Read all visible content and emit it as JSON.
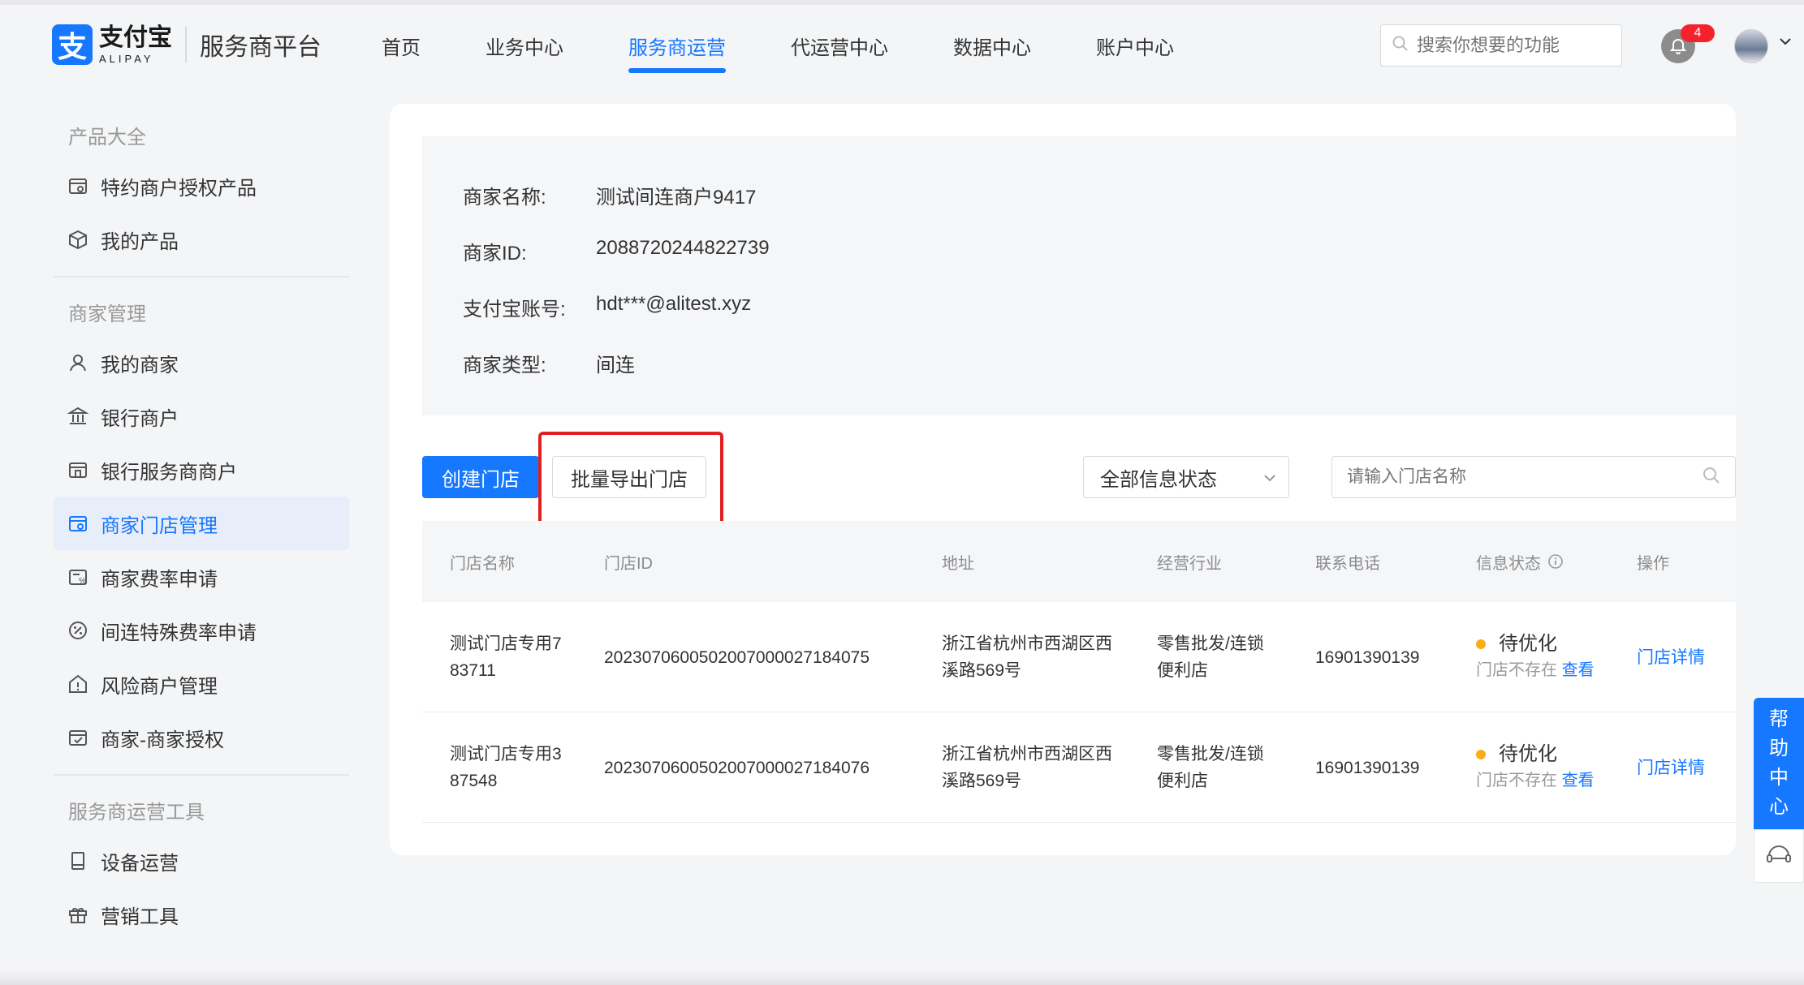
{
  "header": {
    "logo_cn": "支付宝",
    "logo_en": "ALIPAY",
    "platform": "服务商平台",
    "nav": [
      "首页",
      "业务中心",
      "服务商运营",
      "代运营中心",
      "数据中心",
      "账户中心"
    ],
    "active_nav": "服务商运营",
    "search_placeholder": "搜索你想要的功能",
    "notification_count": "4"
  },
  "sidebar": {
    "groups": [
      {
        "title": "产品大全",
        "items": [
          "特约商户授权产品",
          "我的产品"
        ]
      },
      {
        "title": "商家管理",
        "items": [
          "我的商家",
          "银行商户",
          "银行服务商商户",
          "商家门店管理",
          "商家费率申请",
          "间连特殊费率申请",
          "风险商户管理",
          "商家-商家授权"
        ]
      },
      {
        "title": "服务商运营工具",
        "items": [
          "设备运营",
          "营销工具"
        ]
      }
    ],
    "active_item": "商家门店管理"
  },
  "merchant": {
    "name_label": "商家名称:",
    "name": "测试间连商户9417",
    "id_label": "商家ID:",
    "id": "2088720244822739",
    "account_label": "支付宝账号:",
    "account": "hdt***@alitest.xyz",
    "type_label": "商家类型:",
    "type": "间连"
  },
  "toolbar": {
    "create_label": "创建门店",
    "export_label": "批量导出门店",
    "status_select": "全部信息状态",
    "store_search_placeholder": "请输入门店名称"
  },
  "table": {
    "headers": [
      "门店名称",
      "门店ID",
      "地址",
      "经营行业",
      "联系电话",
      "信息状态",
      "操作"
    ],
    "rows": [
      {
        "name_line1": "测试门店专用7",
        "name_line2": "83711",
        "store_id": "2023070600502007000027184075",
        "address_line1": "浙江省杭州市西湖区西",
        "address_line2": "溪路569号",
        "industry_line1": "零售批发/连锁",
        "industry_line2": "便利店",
        "phone": "16901390139",
        "status": "待优化",
        "status_note": "门店不存在",
        "status_link": "查看",
        "action": "门店详情"
      },
      {
        "name_line1": "测试门店专用3",
        "name_line2": "87548",
        "store_id": "2023070600502007000027184076",
        "address_line1": "浙江省杭州市西湖区西",
        "address_line2": "溪路569号",
        "industry_line1": "零售批发/连锁",
        "industry_line2": "便利店",
        "phone": "16901390139",
        "status": "待优化",
        "status_note": "门店不存在",
        "status_link": "查看",
        "action": "门店详情"
      }
    ]
  },
  "help": {
    "chars": [
      "帮",
      "助",
      "中",
      "心"
    ]
  },
  "colors": {
    "accent": "#1677ff",
    "status_pending": "#faad14",
    "highlight": "#e02020"
  }
}
